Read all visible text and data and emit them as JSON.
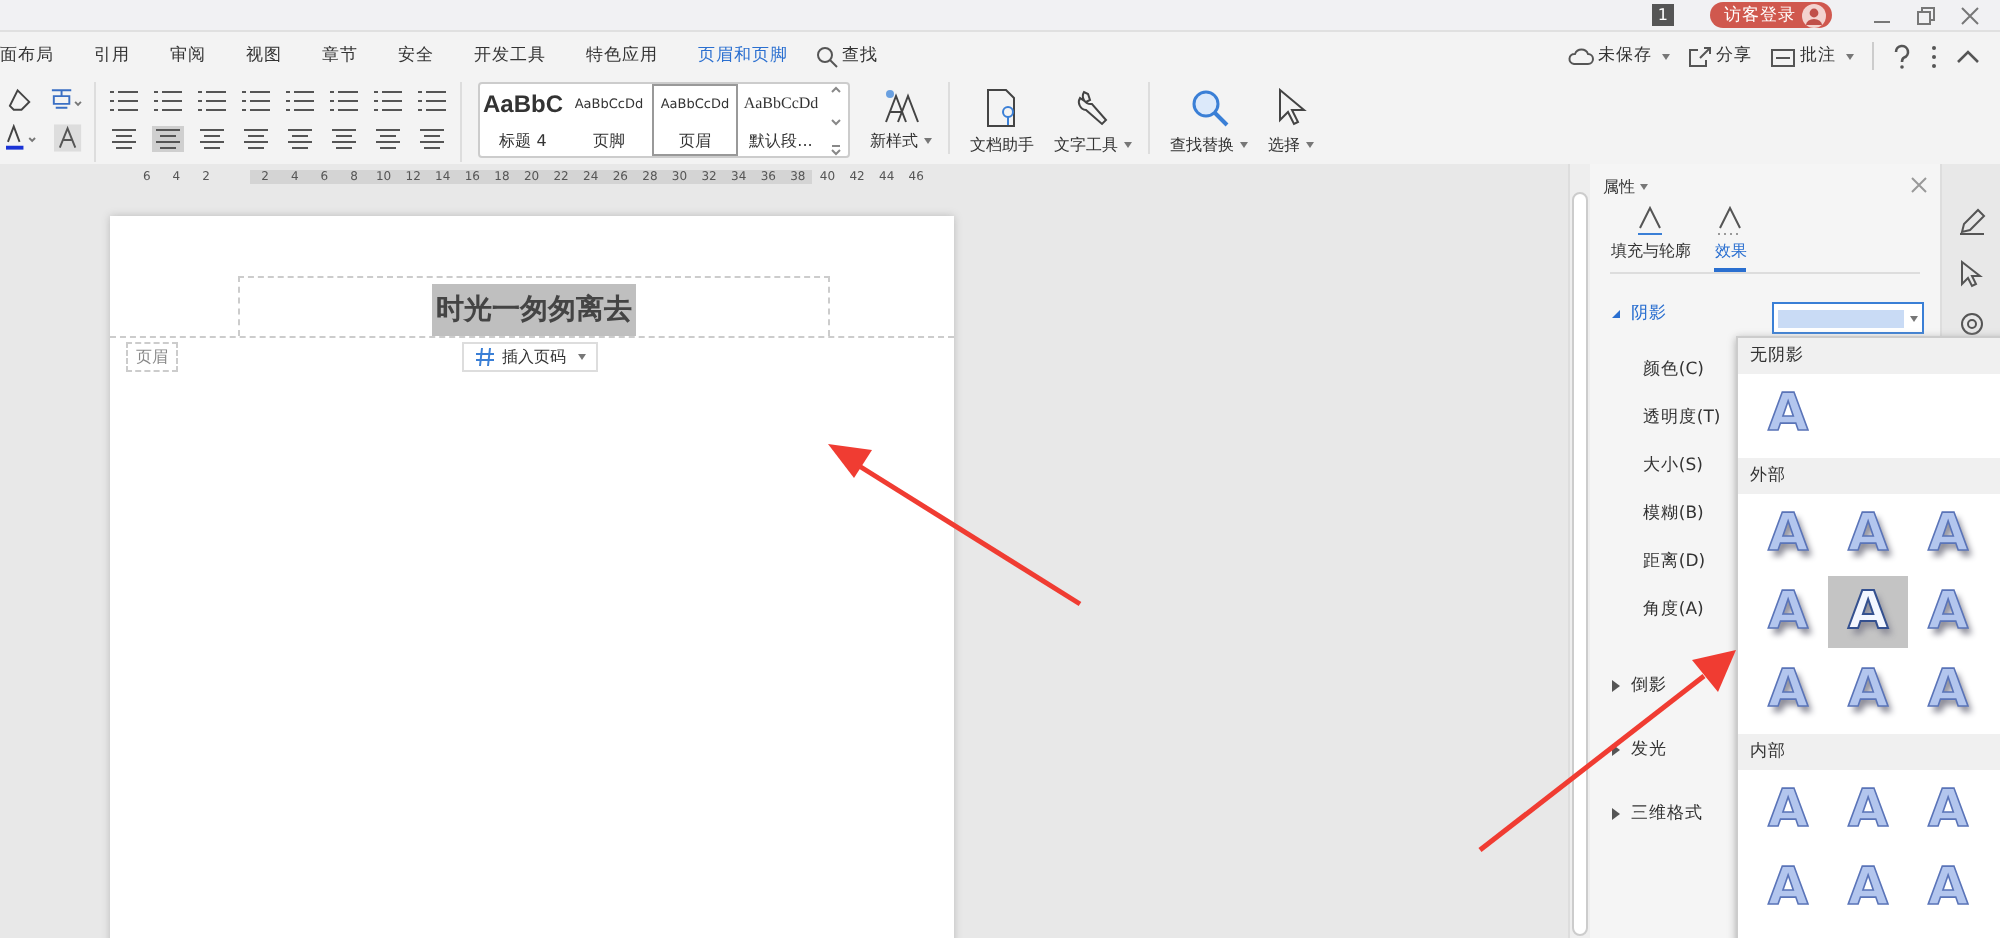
{
  "title_bar": {
    "badge": "1",
    "login": "访客登录"
  },
  "menu_tabs": [
    {
      "label": "面布局",
      "selected": false
    },
    {
      "label": "引用",
      "selected": false
    },
    {
      "label": "审阅",
      "selected": false
    },
    {
      "label": "视图",
      "selected": false
    },
    {
      "label": "章节",
      "selected": false
    },
    {
      "label": "安全",
      "selected": false
    },
    {
      "label": "开发工具",
      "selected": false
    },
    {
      "label": "特色应用",
      "selected": false
    },
    {
      "label": "页眉和页脚",
      "selected": true
    }
  ],
  "search": {
    "label": "查找"
  },
  "actions": [
    {
      "label": "未保存",
      "kind": "cloud",
      "dropdown": true
    },
    {
      "label": "分享",
      "kind": "share",
      "dropdown": false
    },
    {
      "label": "批注",
      "kind": "comment",
      "dropdown": true
    }
  ],
  "styles": [
    {
      "sample": "AaBbC",
      "name": "标题 4",
      "kind": "heading",
      "selected": false
    },
    {
      "sample": "AaBbCcDd",
      "name": "页脚",
      "kind": "small",
      "selected": false
    },
    {
      "sample": "AaBbCcDd",
      "name": "页眉",
      "kind": "small",
      "selected": true
    },
    {
      "sample": "AaBbCcDd",
      "name": "默认段...",
      "kind": "serif",
      "selected": false
    }
  ],
  "tools": [
    {
      "label": "新样式",
      "kind": "style",
      "dropdown": true
    },
    {
      "label": "文档助手",
      "kind": "doc",
      "dropdown": false
    },
    {
      "label": "文字工具",
      "kind": "wrench",
      "dropdown": true
    },
    {
      "label": "查找替换",
      "kind": "search",
      "dropdown": true
    },
    {
      "label": "选择",
      "kind": "cursor",
      "dropdown": true
    }
  ],
  "ruler": [
    "6",
    "4",
    "2",
    "2",
    "4",
    "6",
    "8",
    "10",
    "12",
    "14",
    "16",
    "18",
    "20",
    "22",
    "24",
    "26",
    "28",
    "30",
    "32",
    "34",
    "36",
    "38",
    "40",
    "42",
    "44",
    "46"
  ],
  "document": {
    "header_text": "时光一匆匆离去",
    "header_tag": "页眉",
    "insert_page_number": "插入页码"
  },
  "panel": {
    "title": "属性",
    "tabs": [
      {
        "label": "填充与轮廓",
        "selected": false
      },
      {
        "label": "效果",
        "selected": true
      }
    ],
    "shadow": {
      "label": "阴影",
      "expanded": true
    },
    "fields": [
      "颜色(C)",
      "透明度(T)",
      "大小(S)",
      "模糊(B)",
      "距离(D)",
      "角度(A)"
    ],
    "sections": [
      {
        "label": "倒影",
        "expanded": false
      },
      {
        "label": "发光",
        "expanded": false
      },
      {
        "label": "三维格式",
        "expanded": false
      }
    ]
  },
  "shadow_gallery": [
    {
      "title": "无阴影",
      "tiles": [
        {
          "label": "A",
          "kind": "none",
          "selected": false
        }
      ]
    },
    {
      "title": "外部",
      "tiles": [
        {
          "label": "A",
          "kind": "outer",
          "selected": false
        },
        {
          "label": "A",
          "kind": "outer",
          "selected": false
        },
        {
          "label": "A",
          "kind": "outer",
          "selected": false
        },
        {
          "label": "A",
          "kind": "outer",
          "selected": false
        },
        {
          "label": "A",
          "kind": "outer",
          "selected": true
        },
        {
          "label": "A",
          "kind": "outer",
          "selected": false
        },
        {
          "label": "A",
          "kind": "outer",
          "selected": false
        },
        {
          "label": "A",
          "kind": "outer",
          "selected": false
        },
        {
          "label": "A",
          "kind": "outer",
          "selected": false
        }
      ]
    },
    {
      "title": "内部",
      "tiles": [
        {
          "label": "A",
          "kind": "inner",
          "selected": false
        },
        {
          "label": "A",
          "kind": "inner",
          "selected": false
        },
        {
          "label": "A",
          "kind": "inner",
          "selected": false
        },
        {
          "label": "A",
          "kind": "inner",
          "selected": false
        },
        {
          "label": "A",
          "kind": "inner",
          "selected": false
        },
        {
          "label": "A",
          "kind": "inner",
          "selected": false
        }
      ]
    }
  ]
}
